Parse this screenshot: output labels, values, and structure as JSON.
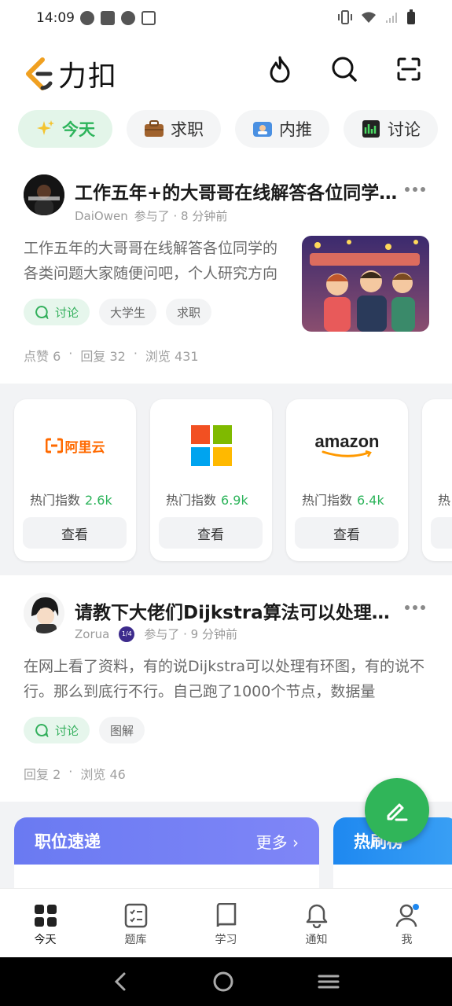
{
  "status_bar": {
    "time": "14:09"
  },
  "app": {
    "logo_text": "力扣"
  },
  "tabs": [
    {
      "label": "今天",
      "icon": "sparkle-icon"
    },
    {
      "label": "求职",
      "icon": "briefcase-icon"
    },
    {
      "label": "内推",
      "icon": "id-card-icon"
    },
    {
      "label": "讨论",
      "icon": "chart-icon"
    }
  ],
  "posts": [
    {
      "title": "工作五年+的大哥哥在线解答各位同学的各类问题",
      "author": "DaiOwen",
      "meta": "参与了 · 8 分钟前",
      "excerpt": "工作五年的大哥哥在线解答各位同学的各类问题大家随便问吧，个人研究方向",
      "tags": [
        "讨论",
        "大学生",
        "求职"
      ],
      "stats": [
        "点赞 6",
        "回复 32",
        "浏览 431"
      ]
    },
    {
      "title": "请教下大佬们Dijkstra算法可以处理有环图吗",
      "author": "Zorua",
      "badge": "1/4",
      "meta": "参与了 · 9 分钟前",
      "excerpt": "在网上看了资料，有的说Dijkstra可以处理有环图，有的说不行。那么到底行不行。自己跑了1000个节点，数据量",
      "tags": [
        "讨论",
        "图解"
      ],
      "stats": [
        "回复 2",
        "浏览 46"
      ]
    }
  ],
  "companies": [
    {
      "name": "阿里云",
      "hot_label": "热门指数",
      "hot_value": "2.6k",
      "button": "查看"
    },
    {
      "name": "Microsoft",
      "hot_label": "热门指数",
      "hot_value": "6.9k",
      "button": "查看"
    },
    {
      "name": "amazon",
      "hot_label": "热门指数",
      "hot_value": "6.4k",
      "button": "查看"
    },
    {
      "name": "",
      "hot_label": "热",
      "hot_value": "",
      "button": ""
    }
  ],
  "promos": [
    {
      "title": "职位速递",
      "more": "更多 ›",
      "color": "#6f7cf5"
    },
    {
      "title": "热刷榜",
      "color": "#1e88f0"
    }
  ],
  "bottom_nav": [
    {
      "label": "今天",
      "icon": "grid-icon"
    },
    {
      "label": "题库",
      "icon": "checklist-icon"
    },
    {
      "label": "学习",
      "icon": "book-icon"
    },
    {
      "label": "通知",
      "icon": "bell-icon"
    },
    {
      "label": "我",
      "icon": "person-icon"
    }
  ],
  "colors": {
    "brand_green": "#2db45b",
    "accent_orange": "#f0a020"
  }
}
